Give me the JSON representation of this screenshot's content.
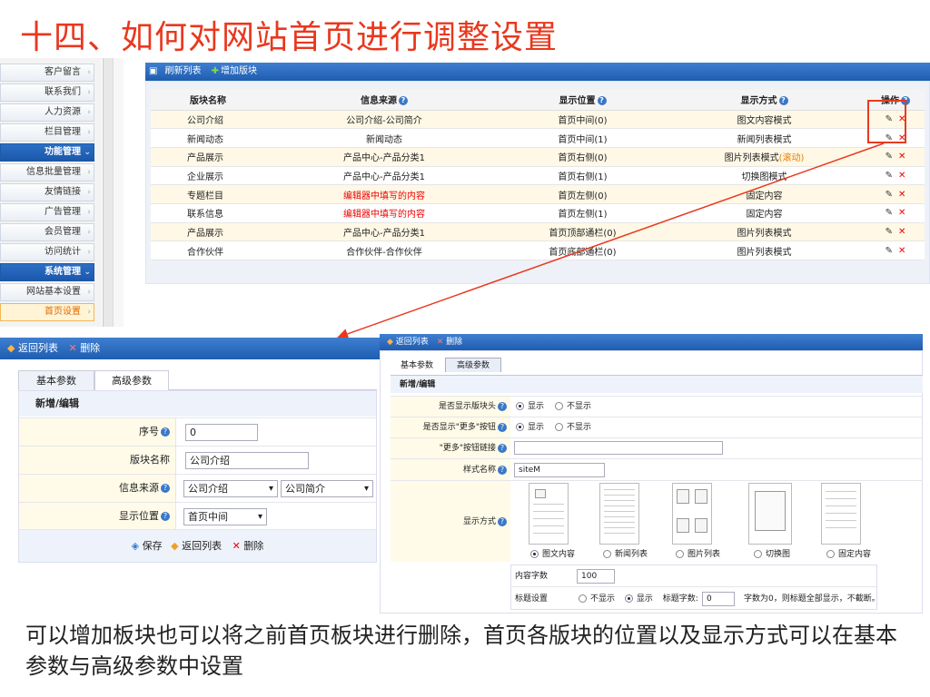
{
  "title": "十四、如何对网站首页进行调整设置",
  "sidebar": {
    "items": [
      {
        "label": "客户留言",
        "type": "item"
      },
      {
        "label": "联系我们",
        "type": "item"
      },
      {
        "label": "人力资源",
        "type": "item"
      },
      {
        "label": "栏目管理",
        "type": "item"
      },
      {
        "label": "功能管理",
        "type": "group"
      },
      {
        "label": "信息批量管理",
        "type": "item"
      },
      {
        "label": "友情链接",
        "type": "item"
      },
      {
        "label": "广告管理",
        "type": "item"
      },
      {
        "label": "会员管理",
        "type": "item"
      },
      {
        "label": "访问统计",
        "type": "item"
      },
      {
        "label": "系统管理",
        "type": "group"
      },
      {
        "label": "网站基本设置",
        "type": "item"
      },
      {
        "label": "首页设置",
        "type": "active"
      }
    ]
  },
  "toolbar": {
    "refresh": "刷新列表",
    "add": "增加版块"
  },
  "grid": {
    "headers": [
      "版块名称",
      "信息来源",
      "显示位置",
      "显示方式",
      "操作"
    ],
    "rows": [
      {
        "name": "公司介绍",
        "source": "公司介绍-公司简介",
        "position": "首页中间(0)",
        "mode": "图文内容模式",
        "mode_extra": ""
      },
      {
        "name": "新闻动态",
        "source": "新闻动态",
        "position": "首页中间(1)",
        "mode": "新闻列表模式",
        "mode_extra": ""
      },
      {
        "name": "产品展示",
        "source": "产品中心-产品分类1",
        "position": "首页右侧(0)",
        "mode": "图片列表模式",
        "mode_extra": "(滚动)"
      },
      {
        "name": "企业展示",
        "source": "产品中心-产品分类1",
        "position": "首页右侧(1)",
        "mode": "切换图模式",
        "mode_extra": ""
      },
      {
        "name": "专题栏目",
        "source": "编辑器中填写的内容",
        "position": "首页左侧(0)",
        "mode": "固定内容",
        "mode_extra": ""
      },
      {
        "name": "联系信息",
        "source": "编辑器中填写的内容",
        "position": "首页左侧(1)",
        "mode": "固定内容",
        "mode_extra": ""
      },
      {
        "name": "产品展示",
        "source": "产品中心-产品分类1",
        "position": "首页顶部通栏(0)",
        "mode": "图片列表模式",
        "mode_extra": ""
      },
      {
        "name": "合作伙伴",
        "source": "合作伙伴-合作伙伴",
        "position": "首页底部通栏(0)",
        "mode": "图片列表模式",
        "mode_extra": ""
      }
    ]
  },
  "editor": {
    "back": "返回列表",
    "delete": "删除",
    "tab_basic": "基本参数",
    "tab_advanced": "高级参数",
    "heading": "新增/编辑",
    "labels": {
      "order": "序号",
      "name": "版块名称",
      "source": "信息来源",
      "position": "显示位置"
    },
    "values": {
      "order": "0",
      "name": "公司介绍",
      "source1": "公司介绍",
      "source2": "公司简介",
      "position": "首页中间"
    },
    "save": "保存",
    "back2": "返回列表",
    "delete2": "删除"
  },
  "advanced": {
    "back": "返回列表",
    "delete": "删除",
    "tab_basic": "基本参数",
    "tab_advanced": "高级参数",
    "heading": "新增/编辑",
    "rows": [
      {
        "label": "是否显示版块头",
        "on": "显示",
        "off": "不显示"
      },
      {
        "label": "是否显示\"更多\"按钮",
        "on": "显示",
        "off": "不显示"
      },
      {
        "label": "\"更多\"按钮链接"
      },
      {
        "label": "样式名称",
        "value": "siteM"
      },
      {
        "label": "显示方式"
      }
    ],
    "modes": [
      "图文内容",
      "新闻列表",
      "图片列表",
      "切换图",
      "固定内容"
    ],
    "content_count_label": "内容字数",
    "content_count": "100",
    "title_setting_label": "标题设置",
    "title_off": "不显示",
    "title_on": "显示",
    "title_count_label": "标题字数:",
    "title_count": "0",
    "title_note": "字数为0，则标题全部显示，不截断。"
  },
  "caption": "可以增加板块也可以将之前首页板块进行删除，首页各版块的位置以及显示方式可以在基本参数与高级参数中设置",
  "colors": {
    "title": "#e8381e",
    "toolbar": "#1e5db0",
    "highlight": "#e83a1e"
  }
}
